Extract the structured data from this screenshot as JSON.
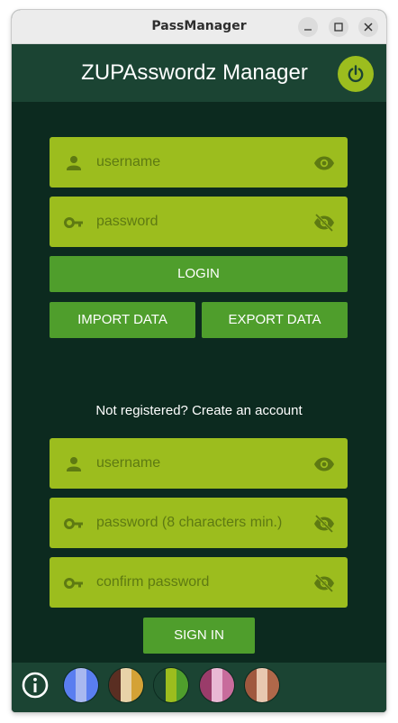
{
  "window": {
    "title": "PassManager",
    "controls": [
      "minimize-icon",
      "maximize-icon",
      "close-icon"
    ]
  },
  "header": {
    "app_title": "ZUPAsswordz Manager",
    "power_icon": "power-icon"
  },
  "login": {
    "username_placeholder": "username",
    "password_placeholder": "password",
    "login_label": "LOGIN",
    "import_label": "IMPORT DATA",
    "export_label": "EXPORT DATA"
  },
  "register": {
    "prompt": "Not registered? Create an account",
    "username_placeholder": "username",
    "password_placeholder": "password (8 characters min.)",
    "confirm_placeholder": "confirm password",
    "signin_label": "SIGN IN"
  },
  "bottom": {
    "info_icon": "info-icon",
    "themes": [
      {
        "name": "blue",
        "colors": [
          "#5a7ef0",
          "#a8b8f0",
          "#5a7ef0"
        ]
      },
      {
        "name": "brown-gold",
        "colors": [
          "#5a2e22",
          "#e8d2a8",
          "#d4a236"
        ]
      },
      {
        "name": "green",
        "colors": [
          "#1b4433",
          "#9cbd1e",
          "#4f9e2c"
        ]
      },
      {
        "name": "pink",
        "colors": [
          "#9a3c6a",
          "#e9b8d4",
          "#c86c9c"
        ]
      },
      {
        "name": "terracotta",
        "colors": [
          "#a0583e",
          "#e8c8b0",
          "#b0684a"
        ]
      }
    ]
  },
  "colors": {
    "background": "#0c2a1f",
    "header": "#1b4433",
    "field": "#9cbd1e",
    "button": "#4f9e2c"
  }
}
